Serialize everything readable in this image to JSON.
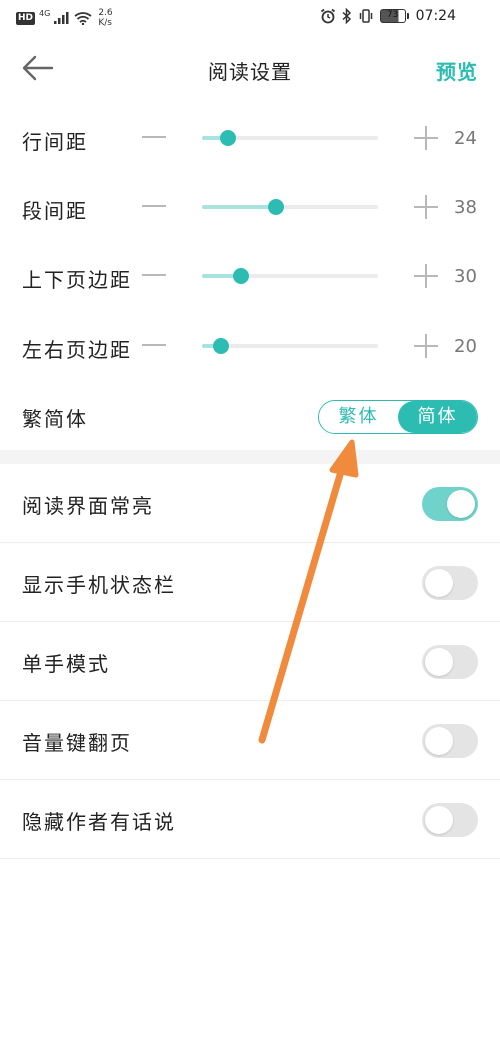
{
  "status_bar": {
    "hd": "HD",
    "network": "4G",
    "speed_value": "2.6",
    "speed_unit": "K/s",
    "battery": "73",
    "time": "07:24"
  },
  "header": {
    "title": "阅读设置",
    "preview_label": "预览",
    "back_icon": "arrow-left-icon"
  },
  "sliders": [
    {
      "label": "行间距",
      "value": "24",
      "fill_fraction": 0.15
    },
    {
      "label": "段间距",
      "value": "38",
      "fill_fraction": 0.42
    },
    {
      "label": "上下页边距",
      "value": "30",
      "fill_fraction": 0.22
    },
    {
      "label": "左右页边距",
      "value": "20",
      "fill_fraction": 0.11
    }
  ],
  "script_toggle": {
    "label": "繁简体",
    "traditional": "繁体",
    "simplified": "简体",
    "selected": "简体"
  },
  "switches": [
    {
      "label": "阅读界面常亮",
      "on": true
    },
    {
      "label": "显示手机状态栏",
      "on": false
    },
    {
      "label": "单手模式",
      "on": false
    },
    {
      "label": "音量键翻页",
      "on": false
    },
    {
      "label": "隐藏作者有话说",
      "on": false
    }
  ],
  "colors": {
    "accent": "#2cbcb2",
    "track_fill": "#a9e3df",
    "switch_on": "#6fd3cc",
    "annotation": "#f08a3c"
  }
}
